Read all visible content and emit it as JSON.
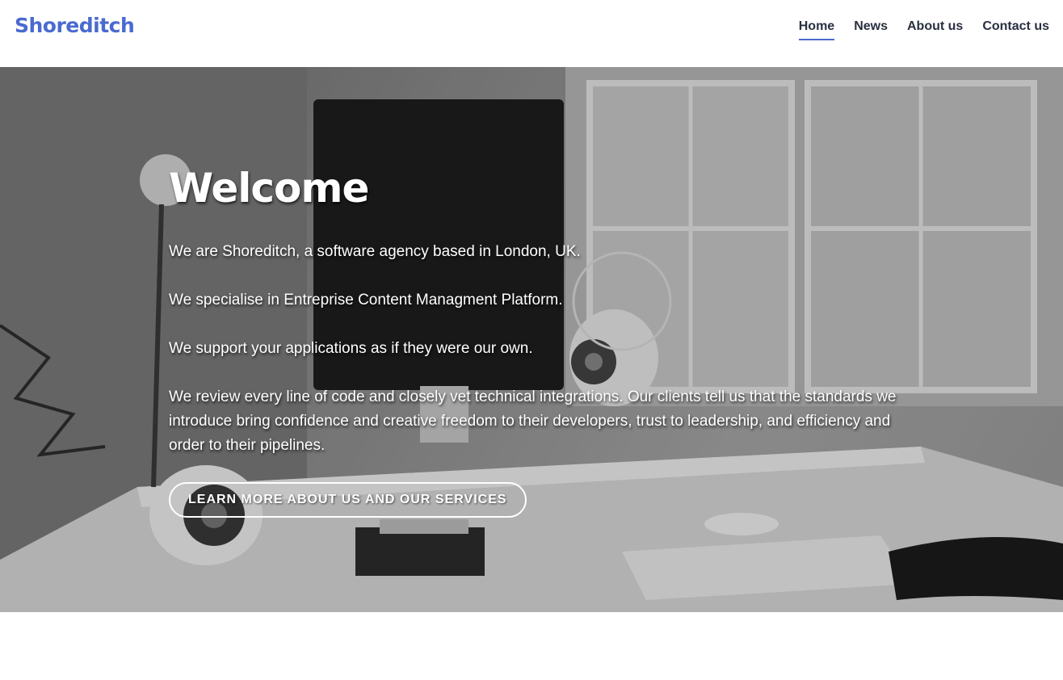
{
  "brand": {
    "name": "Shoreditch",
    "color": "#4a6ad0"
  },
  "nav": {
    "items": [
      {
        "label": "Home",
        "active": true
      },
      {
        "label": "News",
        "active": false
      },
      {
        "label": "About us",
        "active": false
      },
      {
        "label": "Contact us",
        "active": false
      }
    ]
  },
  "hero": {
    "title": "Welcome",
    "paragraphs": [
      "We are Shoreditch, a software agency based in London, UK.",
      "We specialise in Entreprise Content Managment Platform.",
      "We support your applications as if they were our own.",
      "We review every line of code and closely vet technical integrations. Our clients tell us that the standards we introduce bring confidence and creative freedom to their developers, trust to leadership, and efficiency and order to their pipelines."
    ],
    "cta_label": "LEARN MORE ABOUT US AND OUR SERVICES",
    "background_image": "black-and-white desk workspace photo (computer, speakers, lamp, window)"
  }
}
